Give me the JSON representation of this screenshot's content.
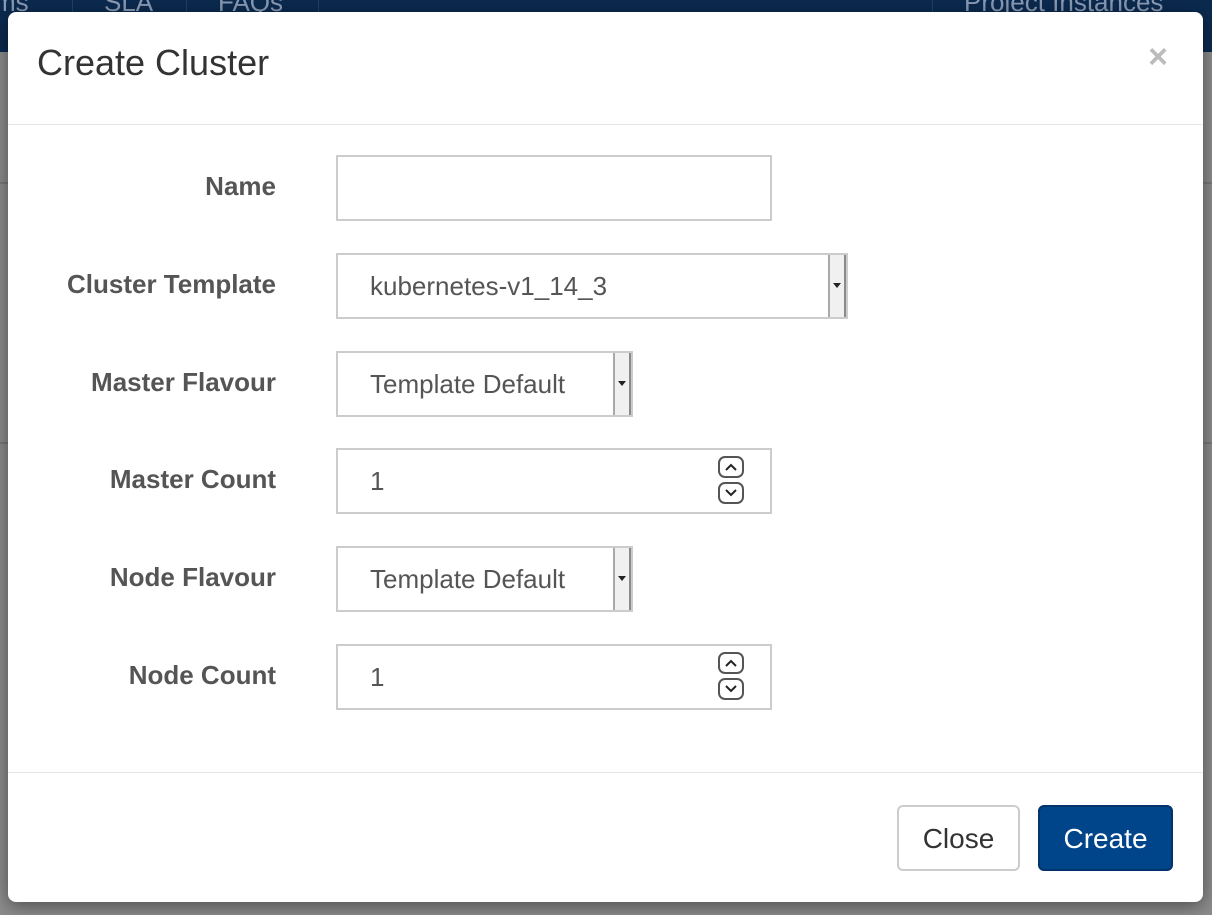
{
  "background": {
    "nav_items": [
      "ms",
      "SLA",
      "FAQs"
    ],
    "nav_right": "Project Instances"
  },
  "modal": {
    "title": "Create Cluster",
    "close_glyph": "×"
  },
  "form": {
    "name": {
      "label": "Name",
      "value": ""
    },
    "cluster_template": {
      "label": "Cluster Template",
      "selected": "kubernetes-v1_14_3"
    },
    "master_flavour": {
      "label": "Master Flavour",
      "selected": "Template Default"
    },
    "master_count": {
      "label": "Master Count",
      "value": "1"
    },
    "node_flavour": {
      "label": "Node Flavour",
      "selected": "Template Default"
    },
    "node_count": {
      "label": "Node Count",
      "value": "1"
    }
  },
  "footer": {
    "close_label": "Close",
    "create_label": "Create"
  },
  "colors": {
    "primary": "#004489",
    "navbar": "#0b2a4f",
    "label": "#555555"
  }
}
